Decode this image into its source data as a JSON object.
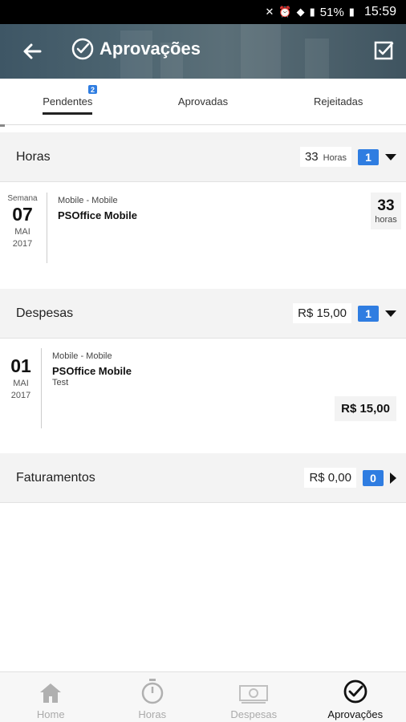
{
  "status_bar": {
    "battery": "51%",
    "time": "15:59"
  },
  "header": {
    "title": "Aprovações"
  },
  "tabs": [
    {
      "label": "Pendentes",
      "badge": "2"
    },
    {
      "label": "Aprovadas"
    },
    {
      "label": "Rejeitadas"
    }
  ],
  "sections": {
    "horas": {
      "title": "Horas",
      "total": "33",
      "unit": "Horas",
      "count": "1",
      "items": [
        {
          "prefix": "Semana",
          "day": "07",
          "month": "MAI",
          "year": "2017",
          "sub": "Mobile - Mobile",
          "name": "PSOffice Mobile",
          "hours": "33",
          "hours_label": "horas"
        }
      ]
    },
    "despesas": {
      "title": "Despesas",
      "total": "R$ 15,00",
      "count": "1",
      "items": [
        {
          "day": "01",
          "month": "MAI",
          "year": "2017",
          "sub": "Mobile - Mobile",
          "name": "PSOffice Mobile",
          "desc": "Test",
          "value": "R$ 15,00"
        }
      ]
    },
    "faturamentos": {
      "title": "Faturamentos",
      "total": "R$ 0,00",
      "count": "0"
    }
  },
  "bottom_nav": [
    {
      "label": "Home",
      "icon": "home-icon"
    },
    {
      "label": "Horas",
      "icon": "stopwatch-icon"
    },
    {
      "label": "Despesas",
      "icon": "money-icon"
    },
    {
      "label": "Aprovações",
      "icon": "check-circle-icon"
    }
  ],
  "colors": {
    "accent": "#2f7de1",
    "header": "#4c6470"
  }
}
